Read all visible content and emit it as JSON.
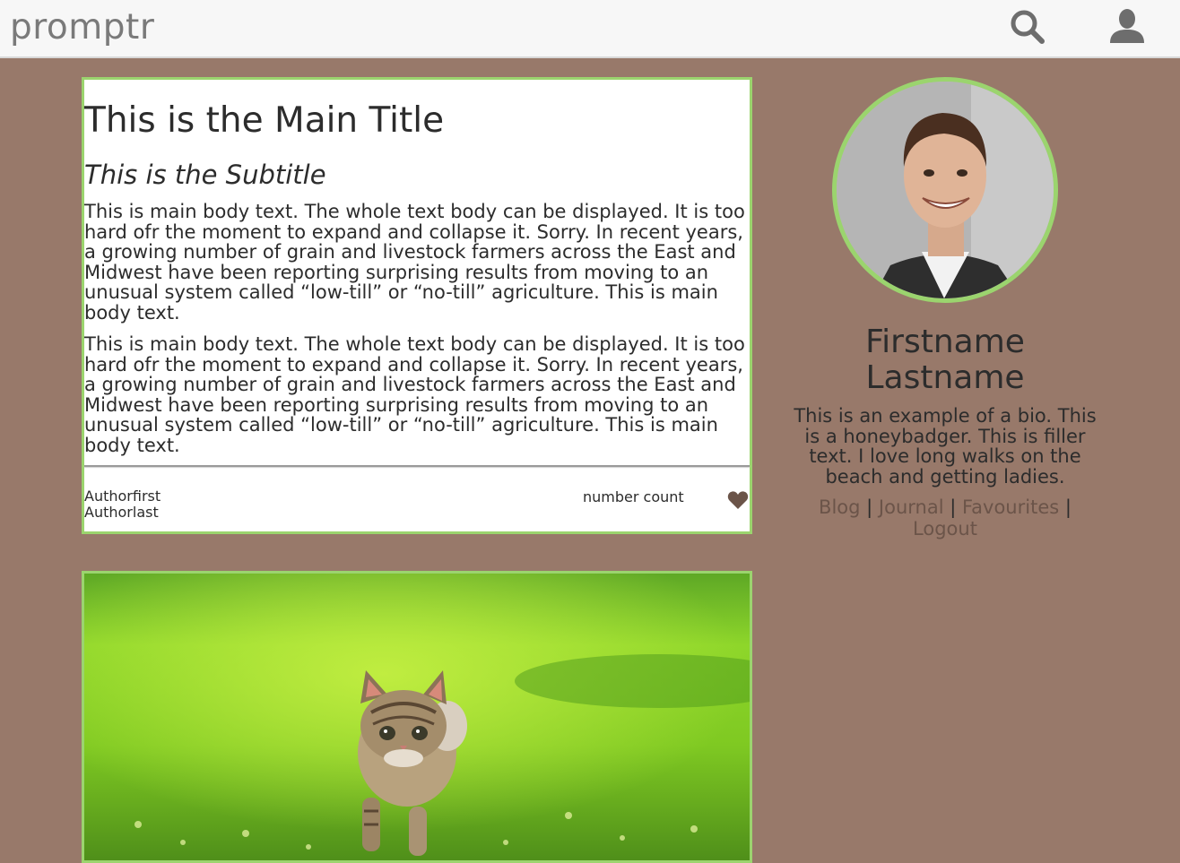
{
  "header": {
    "logo": "promptr",
    "search_icon": "search-icon",
    "user_icon": "user-icon"
  },
  "post": {
    "title": "This is the Main Title",
    "subtitle": "This is the Subtitle",
    "paragraphs": [
      "This is main body text. The whole text body can be displayed. It is too hard ofr the moment to expand and collapse it. Sorry. In recent years, a growing number of grain and livestock farmers across the East and Midwest have been reporting surprising results from moving to an unusual system called “low-till” or “no-till” agriculture. This is main body text.",
      "This is main body text. The whole text body can be displayed. It is too hard ofr the moment to expand and collapse it. Sorry. In recent years, a growing number of grain and livestock farmers across the East and Midwest have been reporting surprising results from moving to an unusual system called “low-till” or “no-till” agriculture. This is main body text."
    ],
    "author_first": "Authorfirst",
    "author_last": "Authorlast",
    "count_label": "number count",
    "heart_icon": "heart-icon"
  },
  "profile": {
    "name_first": "Firstname",
    "name_last": "Lastname",
    "bio": "This is an example of a bio. This is a honeybadger. This is filler text. I love long walks on the beach and getting ladies.",
    "links": {
      "blog": "Blog",
      "journal": "Journal",
      "favourites": "Favourites",
      "logout": "Logout",
      "separator": "|"
    }
  },
  "colors": {
    "background": "#98796a",
    "accent_green": "#9bd46e",
    "link_brown": "#6b5449",
    "heart_brown": "#6b5449",
    "topbar": "#f7f7f7"
  }
}
